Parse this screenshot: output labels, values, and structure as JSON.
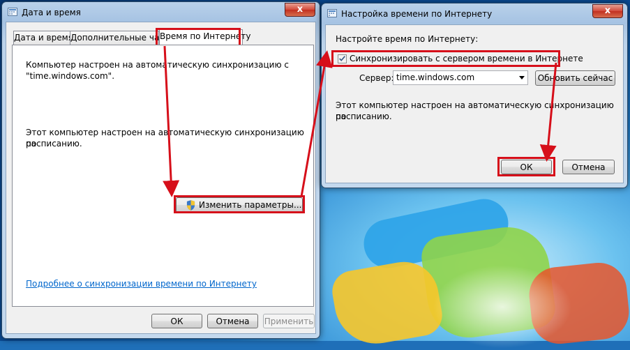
{
  "window_main": {
    "title": "Дата и время",
    "close_label": "x",
    "tabs": [
      {
        "label": "Дата и время"
      },
      {
        "label": "Дополнительные часы"
      },
      {
        "label": "Время по Интернету"
      }
    ],
    "status_line1": "Компьютер настроен на автоматическую синхронизацию с",
    "status_line2": "\"time.windows.com\".",
    "schedule_line1": "Этот компьютер настроен на автоматическую синхронизацию по",
    "schedule_line2": "расписанию.",
    "change_button": "Изменить параметры...",
    "help_link": "Подробнее о синхронизации времени по Интернету",
    "ok": "ОК",
    "cancel": "Отмена",
    "apply": "Применить"
  },
  "window_settings": {
    "title": "Настройка времени по Интернету",
    "close_label": "x",
    "heading": "Настройте время по Интернету:",
    "sync_checkbox_label": "Синхронизировать с сервером времени в Интернете",
    "sync_checked": true,
    "server_label": "Сервер:",
    "server_value": "time.windows.com",
    "update_now": "Обновить сейчас",
    "status_line1": "Этот компьютер настроен на автоматическую синхронизацию по",
    "status_line2": "расписанию.",
    "ok": "ОК",
    "cancel": "Отмена"
  },
  "colors": {
    "highlight": "#d60f1a",
    "link": "#0066cc"
  },
  "icons": {
    "window_icon": "clock-window-icon",
    "shield": "uac-shield-icon",
    "close": "close-icon",
    "dropdown": "chevron-down-icon"
  }
}
